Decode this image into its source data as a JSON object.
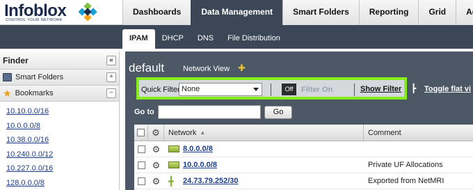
{
  "app": {
    "logo_text": "Infoblox",
    "logo_tagline": "CONTROL YOUR NETWORK"
  },
  "main_tabs": [
    {
      "label": "Dashboards"
    },
    {
      "label": "Data Management"
    },
    {
      "label": "Smart Folders"
    },
    {
      "label": "Reporting"
    },
    {
      "label": "Grid"
    },
    {
      "label": "Ad"
    }
  ],
  "sub_tabs": [
    {
      "label": "IPAM"
    },
    {
      "label": "DHCP"
    },
    {
      "label": "DNS"
    },
    {
      "label": "File Distribution"
    }
  ],
  "finder": {
    "title": "Finder",
    "collapse_icon": "«",
    "smart_folders_label": "Smart Folders",
    "smart_folders_toggle": "+",
    "bookmarks_label": "Bookmarks",
    "bookmarks_toggle": "−",
    "bookmarks": [
      "10.10.0.0/16",
      "10.0.0.0/8",
      "10.38.0.0/16",
      "10.240.0.0/12",
      "10.227.0.0/16",
      "128.0.0.0/8"
    ]
  },
  "main": {
    "title": "default",
    "network_view_label": "Network View",
    "quick_filter_label": "Quick Filter",
    "quick_filter_value": "None",
    "filter_toggle_off": "Off",
    "filter_on_label": "Filter On",
    "show_filter_label": "Show Filter",
    "toggle_flat_label": "Toggle flat vi",
    "goto_label": "Go to",
    "goto_value": "",
    "go_button": "Go"
  },
  "grid": {
    "columns": {
      "network": "Network",
      "comment": "Comment",
      "sort_indicator": "▲"
    },
    "rows": [
      {
        "network": "8.0.0.0/8",
        "comment": "",
        "icon": "network-icon"
      },
      {
        "network": "10.0.0.0/8",
        "comment": "Private UF Allocations",
        "icon": "network-icon"
      },
      {
        "network": "24.73.79.252/30",
        "comment": "Exported from NetMRI",
        "icon": "host-network-icon"
      }
    ]
  },
  "colors": {
    "nav_dark": "#3b4756",
    "panel_bg": "#4c5866",
    "highlight_border": "#84ed1b",
    "link": "#1a3c8a"
  }
}
